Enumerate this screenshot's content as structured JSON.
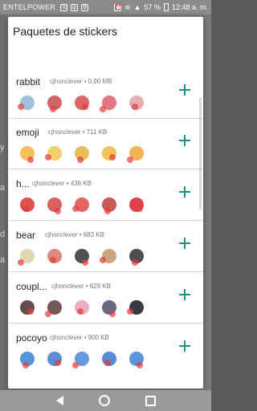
{
  "status_bar": {
    "carrier": "ENTELPOWER",
    "battery": "57 %",
    "time": "12:48 a. m."
  },
  "background_fragments": [
    "y",
    "a",
    "d",
    "a"
  ],
  "dialog": {
    "title": "Paquetes de stickers",
    "packs": [
      {
        "name": "rabbit",
        "author": "cjhonclever",
        "size": "0,90 MB",
        "meta": "cjhonclever • 0,90 MB",
        "add_icon": "plus-icon",
        "sticker_colors": [
          "#8fb6d6",
          "#c94a4a",
          "#d84b4b",
          "#e05d6a",
          "#e3a0a6"
        ]
      },
      {
        "name": "emoji",
        "author": "cjhonclever",
        "size": "711 KB",
        "meta": "cjhonclever • 711 KB",
        "add_icon": "plus-icon",
        "sticker_colors": [
          "#f3b53a",
          "#f1c84c",
          "#e4b13b",
          "#f0b639",
          "#f2a33a"
        ]
      },
      {
        "name": "h...",
        "author": "cjhonclever",
        "size": "436 KB",
        "meta": "cjhonclever • 436 KB",
        "add_icon": "plus-icon",
        "sticker_colors": [
          "#d9342b",
          "#d34545",
          "#e04a4a",
          "#c43b3b",
          "#d91f2a"
        ]
      },
      {
        "name": "bear",
        "author": "cjhonclever",
        "size": "683 KB",
        "meta": "cjhonclever • 683 KB",
        "add_icon": "plus-icon",
        "sticker_colors": [
          "#d9cfa7",
          "#d6766b",
          "#333333",
          "#c6946a",
          "#2f2f2f"
        ]
      },
      {
        "name": "coupl...",
        "author": "cjhonclever",
        "size": "629 KB",
        "meta": "cjhonclever • 629 KB",
        "add_icon": "plus-icon",
        "sticker_colors": [
          "#4a2e2e",
          "#5a3a38",
          "#e7a0b0",
          "#4c4f6e",
          "#101820"
        ]
      },
      {
        "name": "pocoyo",
        "author": "cjhonclever",
        "size": "900 KB",
        "meta": "cjhonclever • 900 KB",
        "add_icon": "plus-icon",
        "sticker_colors": [
          "#3b7fd4",
          "#3a7ad0",
          "#4a86d8",
          "#3677cc",
          "#3e80d6"
        ]
      }
    ]
  },
  "nav": {
    "back_icon": "back-triangle-icon",
    "home_icon": "home-circle-icon",
    "recents_icon": "recents-square-icon"
  }
}
